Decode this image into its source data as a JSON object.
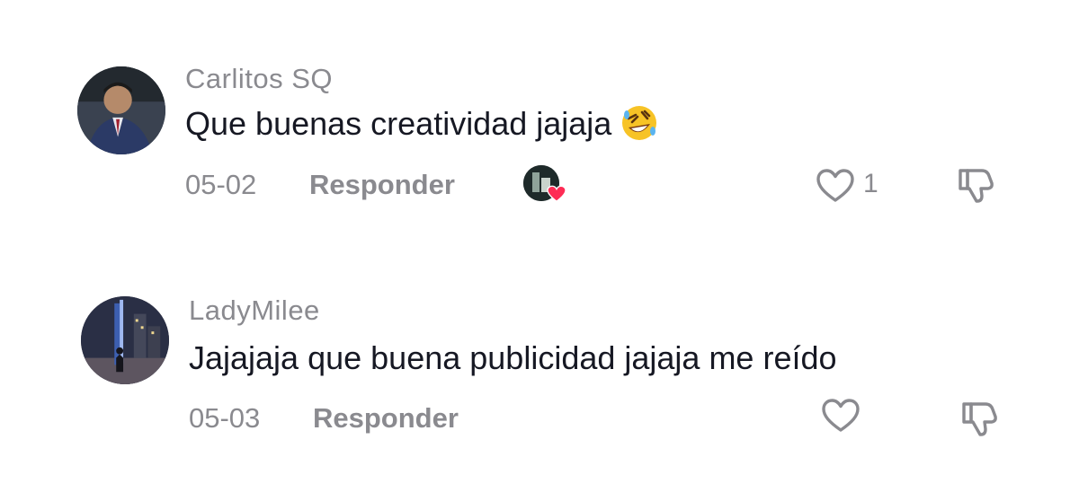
{
  "comments": [
    {
      "username": "Carlitos SQ",
      "text": "Que buenas creatividad jajaja",
      "emoji": "rolling-on-floor-laughing-emoji",
      "date": "05-02",
      "reply_label": "Responder",
      "likes": "1",
      "liked_by_creator": true
    },
    {
      "username": "LadyMilee",
      "text": "Jajajaja que buena publicidad jajaja me reído",
      "date": "05-03",
      "reply_label": "Responder"
    }
  ],
  "colors": {
    "primary_text": "#161823",
    "secondary_text": "#8a8a8f",
    "heart_accent": "#fe2c55",
    "background": "#ffffff"
  }
}
